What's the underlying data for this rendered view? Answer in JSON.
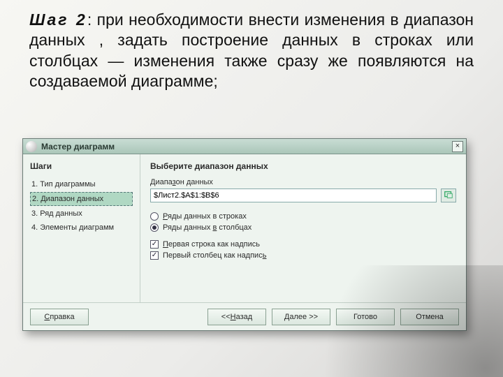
{
  "instruction": {
    "lead": "Шаг 2",
    "rest": ": при необходимости внести изменения в диапазон данных , задать построение данных в строках или столбцах — изменения также сразу же появляются на создаваемой диаграмме;"
  },
  "dialog": {
    "title": "Мастер диаграмм",
    "close_icon": "×",
    "sidebar": {
      "heading": "Шаги",
      "steps": [
        "1. Тип диаграммы",
        "2. Диапазон данных",
        "3. Ряд данных",
        "4. Элементы диаграмм"
      ],
      "active_index": 1
    },
    "main": {
      "heading": "Выберите диапазон данных",
      "range_label": "Диапазон данных",
      "range_value": "$Лист2.$A$1:$B$6",
      "radio_rows": "Ряды данных в строках",
      "radio_cols": "Ряды данных в столбцах",
      "radio_selected": "cols",
      "check_first_row": "Первая строка как надпись",
      "check_first_col": "Первый столбец как надпись",
      "first_row_checked": true,
      "first_col_checked": true
    },
    "footer": {
      "help": "Справка",
      "back": "<<Назад",
      "next": "Далее >>",
      "finish": "Готово",
      "cancel": "Отмена"
    }
  }
}
